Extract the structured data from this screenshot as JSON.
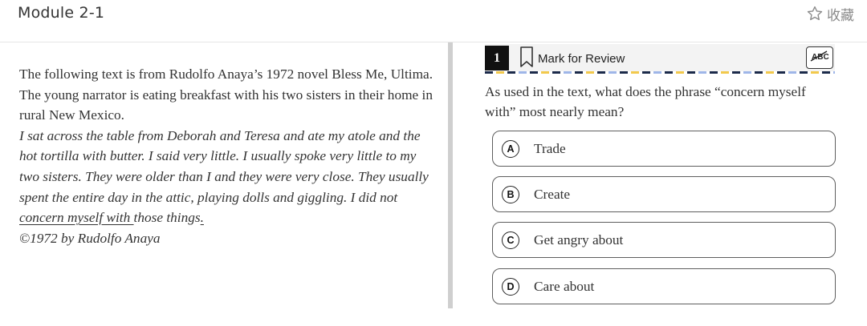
{
  "header": {
    "module_title": "Module 2-1",
    "favorite_label": "收藏",
    "favorite_icon": "star-outline-icon"
  },
  "passage": {
    "intro": "The following text is from Rudolfo Anaya’s 1972 novel Bless Me, Ultima. The young narrator is eating breakfast with his two sisters in their home in rural New Mexico.",
    "excerpt_before": "I sat across the table from Deborah and Teresa and ate my atole and the hot tortilla with butter. I said very little. I usually spoke very little to my two sisters. They were older than I and they were very close. They usually spent the entire day in the attic, playing dolls and giggling. I did not ",
    "excerpt_underlined": "concern myself with ",
    "excerpt_after": "those things",
    "excerpt_end": ".",
    "copyright": "©1972 by Rudolfo Anaya"
  },
  "question_panel": {
    "number": "1",
    "mark_label": "Mark for Review",
    "bookmark_icon": "bookmark-icon",
    "tool_icon": "abc-strikethrough-icon",
    "prompt": "As used in the text, what does the phrase “concern myself with” most nearly mean?",
    "choices": [
      {
        "letter": "A",
        "text": "Trade"
      },
      {
        "letter": "B",
        "text": "Create"
      },
      {
        "letter": "C",
        "text": "Get angry about"
      },
      {
        "letter": "D",
        "text": "Care about"
      }
    ]
  },
  "colors": {
    "divider": "#cfcfcf",
    "choice_border": "#5e5e5e",
    "dash_navy": "#1b2a4a",
    "dash_yellow": "#f2c94c",
    "dash_blue": "#9fb6e8"
  }
}
